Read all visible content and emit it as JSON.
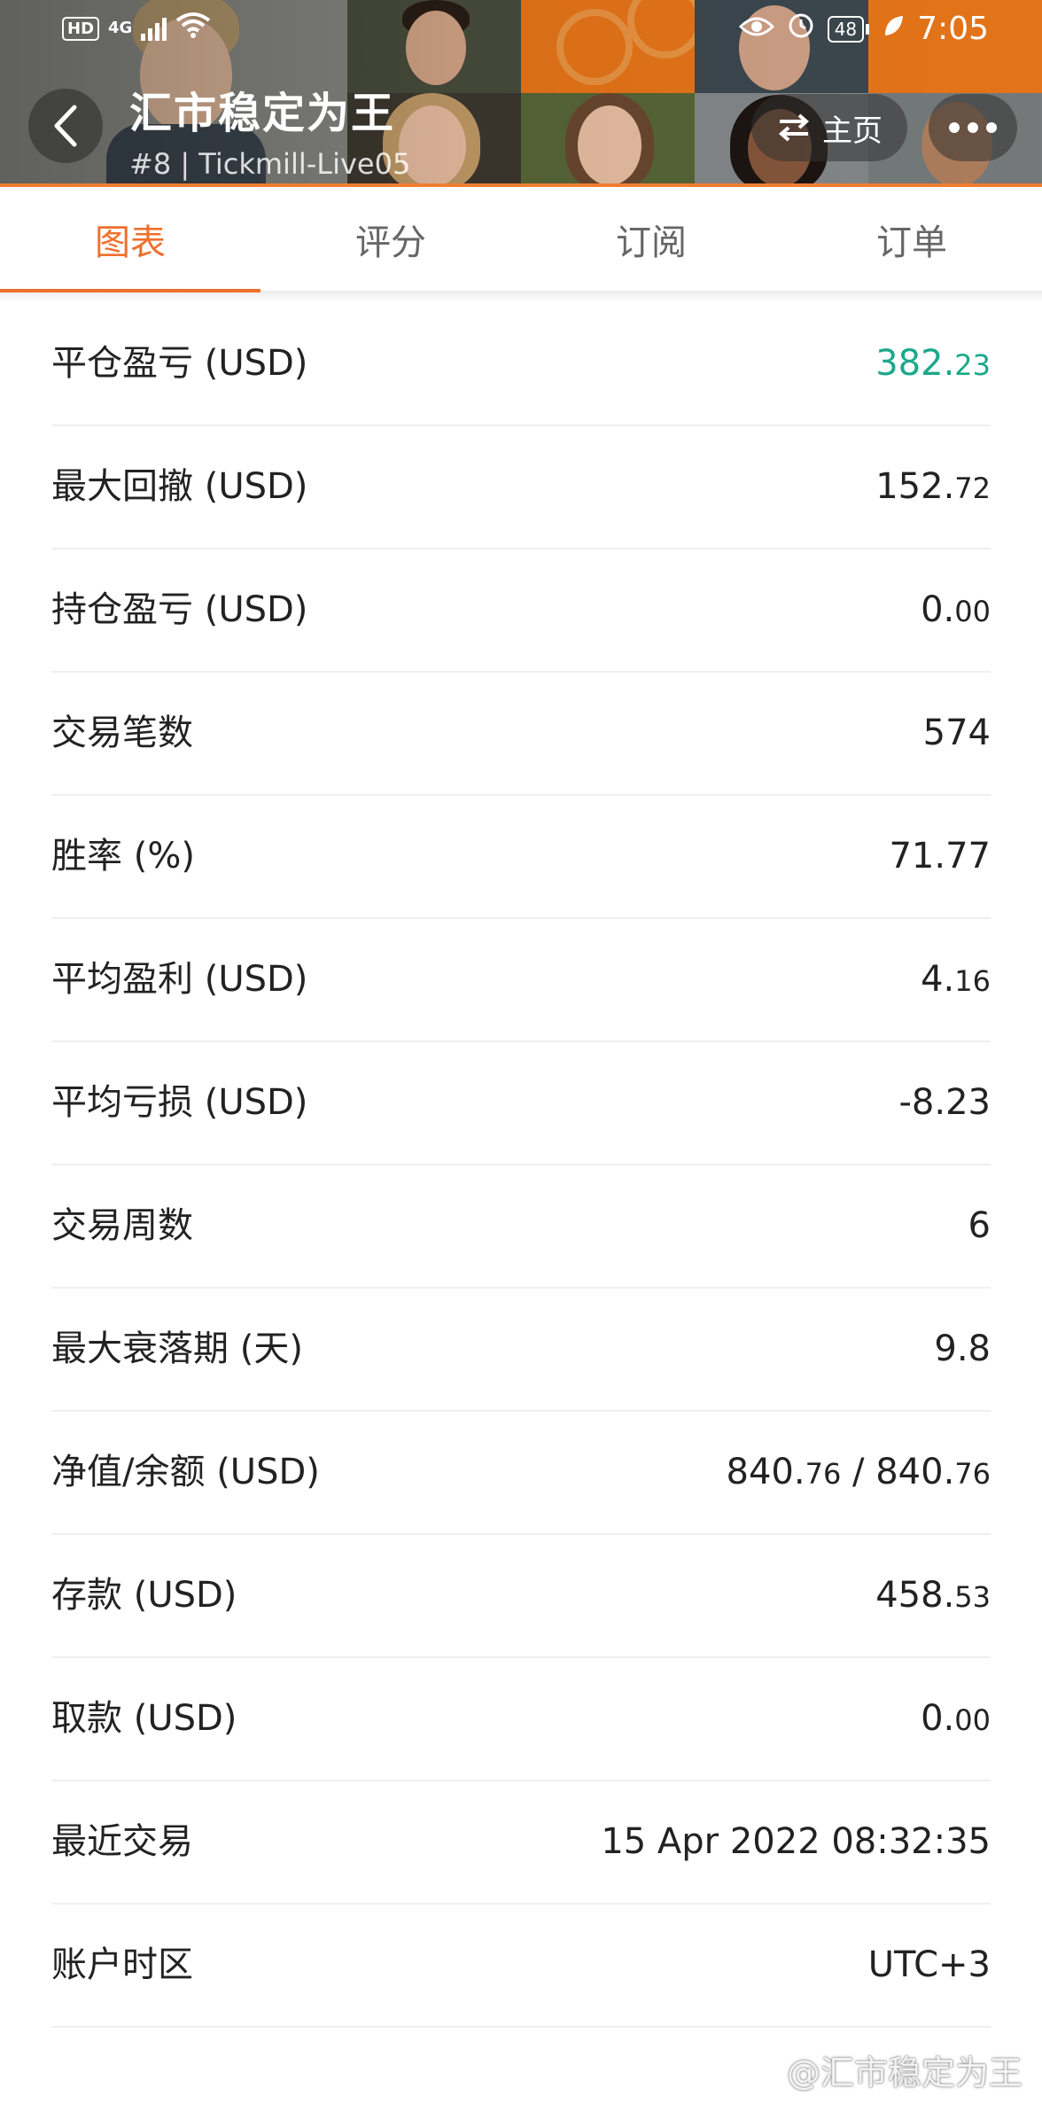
{
  "status_bar": {
    "hd": "HD",
    "network": "4G",
    "battery": "48",
    "time": "7:05"
  },
  "header": {
    "title": "汇市稳定为王",
    "subtitle": "#8 | Tickmill-Live05",
    "home_label": "主页"
  },
  "tabs": [
    {
      "label": "图表",
      "active": true
    },
    {
      "label": "评分",
      "active": false
    },
    {
      "label": "订阅",
      "active": false
    },
    {
      "label": "订单",
      "active": false
    }
  ],
  "stats": [
    {
      "label": "平仓盈亏 (USD)",
      "value_main": "382.",
      "value_small": "23",
      "color": "#1aa98a"
    },
    {
      "label": "最大回撤 (USD)",
      "value_main": "152.",
      "value_small": "72"
    },
    {
      "label": "持仓盈亏 (USD)",
      "value_main": "0.",
      "value_small": "00"
    },
    {
      "label": "交易笔数",
      "value_main": "574",
      "value_small": ""
    },
    {
      "label": "胜率 (%)",
      "value_main": "71.77",
      "value_small": ""
    },
    {
      "label": "平均盈利 (USD)",
      "value_main": "4.",
      "value_small": "16"
    },
    {
      "label": "平均亏损 (USD)",
      "value_main": "-8.23",
      "value_small": ""
    },
    {
      "label": "交易周数",
      "value_main": "6",
      "value_small": ""
    },
    {
      "label": "最大衰落期 (天)",
      "value_main": "9.8",
      "value_small": ""
    },
    {
      "label": "净值/余额 (USD)",
      "value_main": "840.",
      "value_small": "76",
      "value_main2": " / 840.",
      "value_small2": "76"
    },
    {
      "label": "存款 (USD)",
      "value_main": "458.",
      "value_small": "53"
    },
    {
      "label": "取款 (USD)",
      "value_main": "0.",
      "value_small": "00"
    },
    {
      "label": "最近交易",
      "value_main": "15 Apr 2022 08:32:35",
      "value_small": ""
    },
    {
      "label": "账户时区",
      "value_main": "UTC+3",
      "value_small": ""
    }
  ],
  "watermark": "@汇市稳定为王",
  "colors": {
    "accent": "#ef6f2d",
    "profit_green": "#1aa98a"
  }
}
